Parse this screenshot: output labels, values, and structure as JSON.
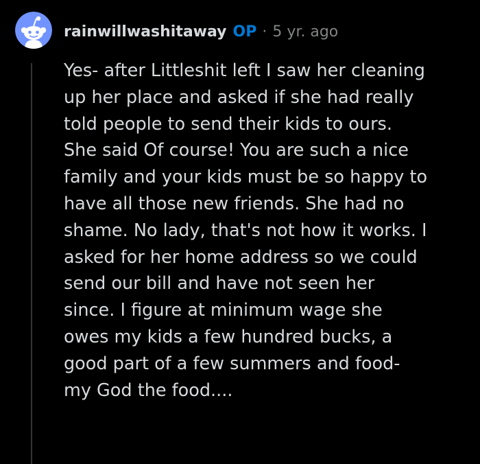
{
  "comment": {
    "author": "rainwillwashitaway",
    "op_badge": "OP",
    "separator": "·",
    "age": "5 yr. ago",
    "avatar_icon": "reddit-snoo-avatar-icon",
    "avatar_bg": "#7193ff",
    "body_lines": [
      "Yes- after Littleshit left I saw her cleaning",
      "up her place and asked if she had really",
      "told people to send their kids to ours.",
      "She said Of course! You are such a nice",
      "family and your kids must be so happy to",
      "have all those new friends. She had no",
      "shame. No lady, that's not how it works. I",
      "asked for her home address so we could",
      "send our bill and have not seen her",
      "since. I figure at minimum wage she",
      "owes my kids a few hundred bucks, a",
      "good part of a few summers and food-",
      "my God the food...."
    ]
  },
  "colors": {
    "background": "#000000",
    "text": "#d7dadc",
    "meta": "#818384",
    "op_accent": "#0079d3",
    "thread_line": "#343536"
  }
}
